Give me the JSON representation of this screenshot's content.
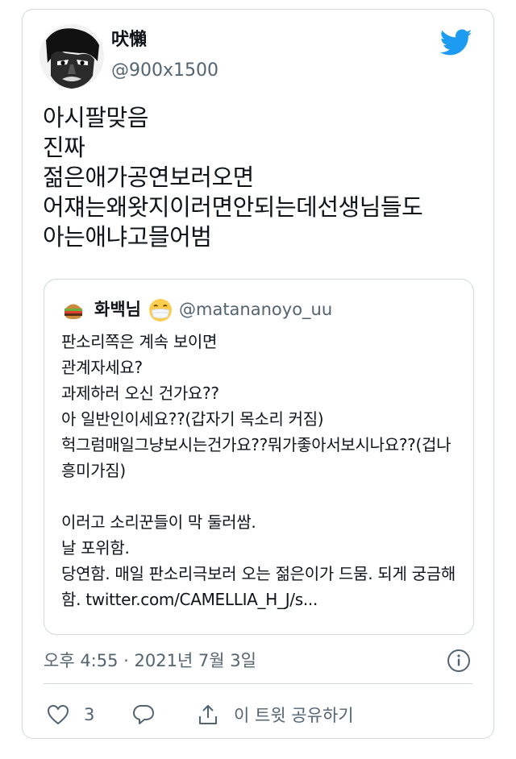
{
  "author": {
    "display_name": "吠懶",
    "handle": "@900x1500"
  },
  "tweet": {
    "text": "아시팔맞음\n진짜\n젊은애가공연보러오면\n어쟤는왜왓지이러면안되는데선생님들도\n아는애냐고믈어범"
  },
  "quoted": {
    "display_name": "화백님",
    "handle": "@matananoyo_uu",
    "text": "판소리쪽은 계속 보이면\n관계자세요?\n과제하러 오신 건가요??\n아 일반인이세요??(갑자기 목소리 커짐)\n헉그럼매일그냥보시는건가요??뭐가좋아서보시나요??(겁나흥미가짐)\n\n이러고 소리꾼들이 막 둘러쌈.\n날 포위함.\n당연함. 매일 판소리극보러 오는 젊은이가 드뭄. 되게 궁금해함. twitter.com/CAMELLIA_H_J/s..."
  },
  "meta": {
    "timestamp": "오후 4:55 · 2021년 7월 3일"
  },
  "actions": {
    "like_count": "3",
    "share_label": "이 트윗 공유하기"
  },
  "icons": {
    "brand": "twitter-bird-icon",
    "info": "info-icon",
    "like": "heart-icon",
    "reply": "reply-icon",
    "share": "share-icon",
    "quote_emoji": "mask-face-emoji"
  },
  "colors": {
    "twitter_blue": "#1d9bf0",
    "secondary_text": "#536471",
    "border": "#cfd9de"
  }
}
